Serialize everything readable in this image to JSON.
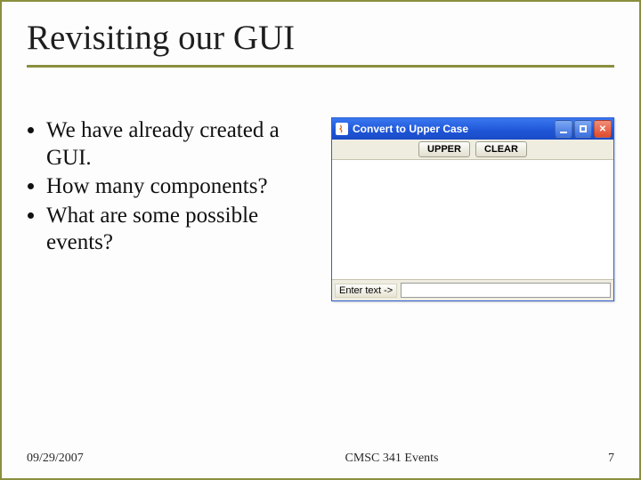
{
  "slide": {
    "title": "Revisiting our GUI",
    "bullets": [
      "We have already created a GUI.",
      "How many components?",
      "What are some possible events?"
    ]
  },
  "window": {
    "title": "Convert to Upper Case",
    "buttons": {
      "upper": "UPPER",
      "clear": "CLEAR"
    },
    "input_label": "Enter text ->",
    "input_value": ""
  },
  "footer": {
    "date": "09/29/2007",
    "course": "CMSC 341 Events",
    "page": "7"
  }
}
